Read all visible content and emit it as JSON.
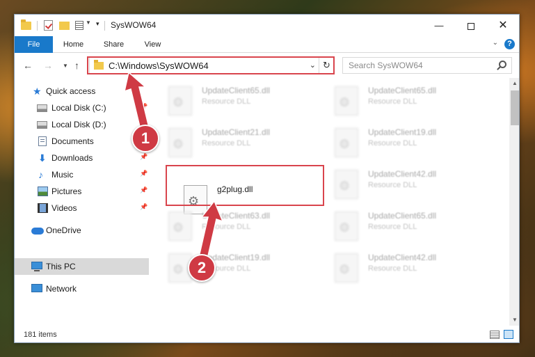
{
  "window": {
    "title": "SysWOW64",
    "min_glyph": "—",
    "close_glyph": "✕"
  },
  "ribbon": {
    "tabs": [
      {
        "label": "File"
      },
      {
        "label": "Home"
      },
      {
        "label": "Share"
      },
      {
        "label": "View"
      }
    ],
    "help_label": "?"
  },
  "address_bar": {
    "path": "C:\\Windows\\SysWOW64"
  },
  "search": {
    "placeholder": "Search SysWOW64"
  },
  "sidebar": {
    "items": [
      {
        "label": "Quick access",
        "icon": "star-icon"
      },
      {
        "label": "Local Disk (C:)",
        "icon": "disk-icon",
        "pinned": true
      },
      {
        "label": "Local Disk (D:)",
        "icon": "disk-icon",
        "pinned": true
      },
      {
        "label": "Documents",
        "icon": "documents-icon",
        "pinned": true
      },
      {
        "label": "Downloads",
        "icon": "downloads-icon",
        "pinned": true
      },
      {
        "label": "Music",
        "icon": "music-icon",
        "pinned": true
      },
      {
        "label": "Pictures",
        "icon": "pictures-icon",
        "pinned": true
      },
      {
        "label": "Videos",
        "icon": "videos-icon",
        "pinned": true
      },
      {
        "label": "OneDrive",
        "icon": "onedrive-icon"
      },
      {
        "label": "This PC",
        "icon": "pc-icon",
        "selected": true
      },
      {
        "label": "Network",
        "icon": "network-icon"
      }
    ]
  },
  "files": [
    {
      "name": "UpdateClient65.dll",
      "desc": "Resource DLL"
    },
    {
      "name": "UpdateClient65.dll",
      "desc": "Resource DLL"
    },
    {
      "name": "UpdateClient21.dll",
      "desc": "Resource DLL"
    },
    {
      "name": "UpdateClient19.dll",
      "desc": "Resource DLL"
    },
    {
      "name": "g2plug.dll",
      "desc": ""
    },
    {
      "name": "UpdateClient42.dll",
      "desc": "Resource DLL"
    },
    {
      "name": "UpdateClient63.dll",
      "desc": "Resource DLL"
    },
    {
      "name": "UpdateClient65.dll",
      "desc": "Resource DLL"
    },
    {
      "name": "UpdateClient19.dll",
      "desc": "Resource DLL"
    },
    {
      "name": "UpdateClient42.dll",
      "desc": "Resource DLL"
    }
  ],
  "status": {
    "item_count": "181 items"
  },
  "annotations": {
    "step1": "1",
    "step2": "2",
    "color": "#d9444c"
  }
}
